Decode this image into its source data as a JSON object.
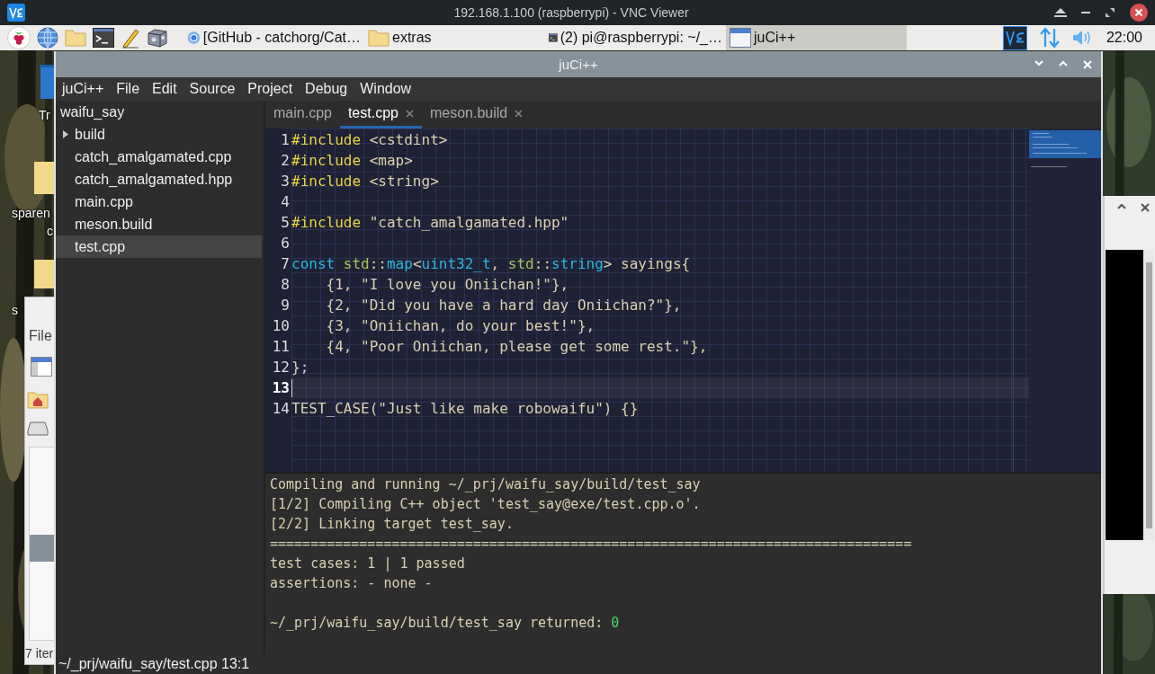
{
  "vnc_window": {
    "title": "192.168.1.100 (raspberrypi) - VNC Viewer"
  },
  "taskbar": {
    "tasks": [
      {
        "label": "[GitHub - catchorg/Cat…",
        "kind": "browser",
        "selected": false
      },
      {
        "label": "extras",
        "kind": "folder",
        "selected": false
      },
      {
        "label": "(2) pi@raspberrypi: ~/_…",
        "kind": "terminal",
        "selected": false
      },
      {
        "label": "juCi++",
        "kind": "window",
        "selected": true
      }
    ],
    "clock": "22:00"
  },
  "desktop_icons": [
    {
      "label": "Tr"
    },
    {
      "label": "sparen"
    },
    {
      "label": "c"
    },
    {
      "label": "s"
    }
  ],
  "file_manager_window": {
    "menu": "File",
    "status": "7 iter"
  },
  "window": {
    "title": "juCi++"
  },
  "menu": [
    "juCi++",
    "File",
    "Edit",
    "Source",
    "Project",
    "Debug",
    "Window"
  ],
  "project_tree": {
    "root": "waifu_say",
    "items": [
      {
        "label": "build",
        "kind": "folder",
        "expanded": false,
        "selected": false
      },
      {
        "label": "catch_amalgamated.cpp",
        "kind": "file",
        "selected": false
      },
      {
        "label": "catch_amalgamated.hpp",
        "kind": "file",
        "selected": false
      },
      {
        "label": "main.cpp",
        "kind": "file",
        "selected": false
      },
      {
        "label": "meson.build",
        "kind": "file",
        "selected": false
      },
      {
        "label": "test.cpp",
        "kind": "file",
        "selected": true
      }
    ]
  },
  "tabs": [
    {
      "label": "main.cpp",
      "selected": false,
      "closable": false
    },
    {
      "label": "test.cpp",
      "selected": true,
      "closable": true
    },
    {
      "label": "meson.build",
      "selected": false,
      "closable": true
    }
  ],
  "editor": {
    "lines": [
      {
        "number": "1",
        "current": false,
        "tokens": [
          {
            "kind": "preproc",
            "text": "#include"
          },
          {
            "kind": "plain",
            "text": " <cstdint>"
          }
        ]
      },
      {
        "number": "2",
        "current": false,
        "tokens": [
          {
            "kind": "preproc",
            "text": "#include"
          },
          {
            "kind": "plain",
            "text": " <map>"
          }
        ]
      },
      {
        "number": "3",
        "current": false,
        "tokens": [
          {
            "kind": "preproc",
            "text": "#include"
          },
          {
            "kind": "plain",
            "text": " <string>"
          }
        ]
      },
      {
        "number": "4",
        "current": false
      },
      {
        "number": "5",
        "current": false,
        "tokens": [
          {
            "kind": "preproc",
            "text": "#include"
          },
          {
            "kind": "plain",
            "text": " \"catch_amalgamated.hpp\""
          }
        ]
      },
      {
        "number": "6",
        "current": false
      },
      {
        "number": "7",
        "current": false,
        "tokens": [
          {
            "kind": "keyword",
            "text": "const"
          },
          {
            "kind": "namespace",
            "text": " std"
          },
          {
            "kind": "plain",
            "text": "::"
          },
          {
            "kind": "keyword",
            "text": "map"
          },
          {
            "kind": "plain",
            "text": "<"
          },
          {
            "kind": "keyword",
            "text": "uint32_t"
          },
          {
            "kind": "plain",
            "text": ", "
          },
          {
            "kind": "namespace",
            "text": "std"
          },
          {
            "kind": "plain",
            "text": "::"
          },
          {
            "kind": "keyword",
            "text": "string"
          },
          {
            "kind": "plain",
            "text": "> sayings{"
          }
        ]
      },
      {
        "number": "8",
        "current": false,
        "tokens": [
          {
            "kind": "plain",
            "text": "    {1, \"I love you Oniichan!\"},"
          }
        ]
      },
      {
        "number": "9",
        "current": false,
        "tokens": [
          {
            "kind": "plain",
            "text": "    {2, \"Did you have a hard day Oniichan?\"},"
          }
        ]
      },
      {
        "number": "10",
        "current": false,
        "tokens": [
          {
            "kind": "plain",
            "text": "    {3, \"Oniichan, do your best!\"},"
          }
        ]
      },
      {
        "number": "11",
        "current": false,
        "tokens": [
          {
            "kind": "plain",
            "text": "    {4, \"Poor Oniichan, please get some rest.\"},"
          }
        ]
      },
      {
        "number": "12",
        "current": false,
        "tokens": [
          {
            "kind": "plain",
            "text": "};"
          }
        ]
      },
      {
        "number": "13",
        "current": true
      },
      {
        "number": "14",
        "current": false,
        "tokens": [
          {
            "kind": "plain",
            "text": "TEST_CASE(\"Just like make robowaifu\") {}"
          }
        ]
      }
    ]
  },
  "terminal": {
    "lines": [
      {
        "tokens": [
          {
            "kind": "plain",
            "text": "Compiling and running ~/_prj/waifu_say/build/test_say"
          }
        ]
      },
      {
        "tokens": [
          {
            "kind": "plain",
            "text": "[1/2] Compiling C++ object 'test_say@exe/test.cpp.o'."
          }
        ]
      },
      {
        "tokens": [
          {
            "kind": "plain",
            "text": "[2/2] Linking target test_say."
          }
        ]
      },
      {
        "tokens": [
          {
            "kind": "plain",
            "text": "==============================================================================="
          }
        ]
      },
      {
        "tokens": [
          {
            "kind": "plain",
            "text": "test cases: 1 | 1 passed"
          }
        ]
      },
      {
        "tokens": [
          {
            "kind": "plain",
            "text": "assertions: - none -"
          }
        ]
      },
      {
        "kind": "summary",
        "tokens": [
          {
            "kind": "plain",
            "text": "~/_prj/waifu_say/build/test_say returned: "
          },
          {
            "kind": "success",
            "text": "0"
          }
        ]
      }
    ]
  },
  "status_bar": "~/_prj/waifu_say/test.cpp 13:1"
}
